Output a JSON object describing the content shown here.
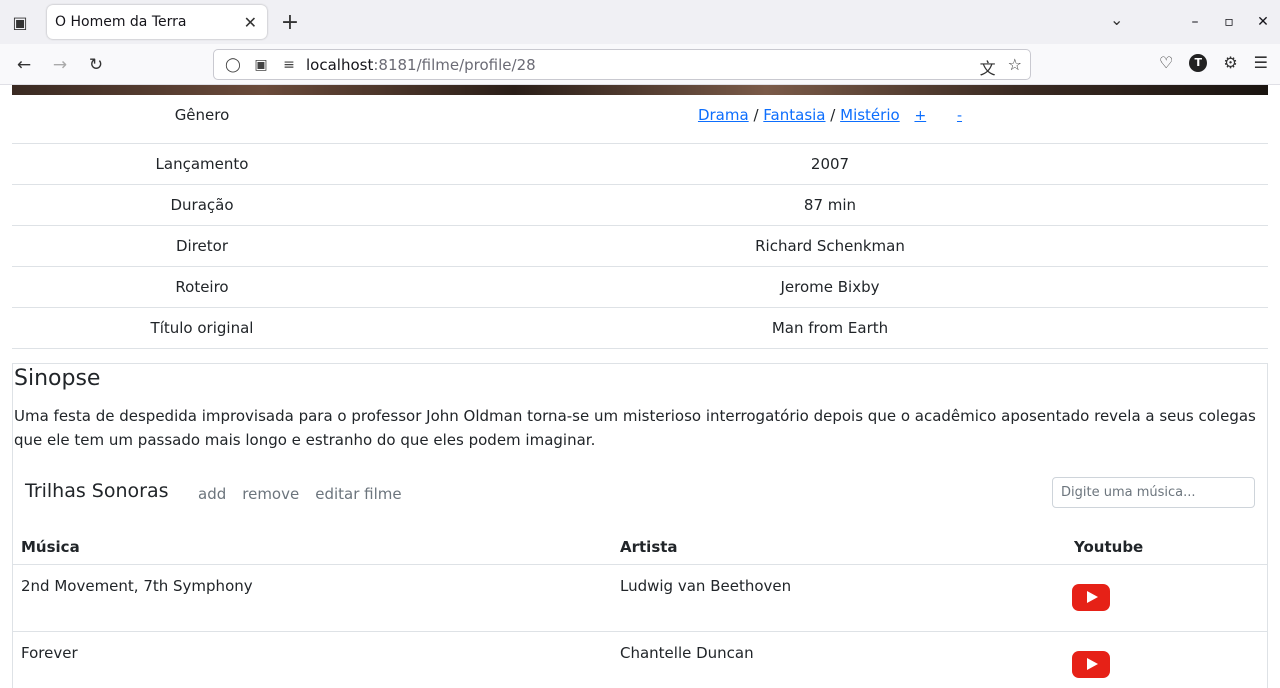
{
  "browser": {
    "tab_title": "O Homem da Terra",
    "url_host": "localhost",
    "url_path": ":8181/filme/profile/28",
    "avatar_letter": "T"
  },
  "info": {
    "genre_label": "Gênero",
    "genres": [
      "Drama",
      "Fantasia",
      "Mistério"
    ],
    "genre_add": "+",
    "genre_remove": "-",
    "rows": [
      {
        "label": "Lançamento",
        "value": "2007"
      },
      {
        "label": "Duração",
        "value": "87 min"
      },
      {
        "label": "Diretor",
        "value": "Richard Schenkman"
      },
      {
        "label": "Roteiro",
        "value": "Jerome Bixby"
      },
      {
        "label": "Título original",
        "value": "Man from Earth"
      }
    ]
  },
  "synopsis": {
    "title": "Sinopse",
    "text": "Uma festa de despedida improvisada para o professor John Oldman torna-se um misterioso interrogatório depois que o acadêmico aposentado revela a seus colegas que ele tem um passado mais longo e estranho do que eles podem imaginar."
  },
  "tracks": {
    "title": "Trilhas Sonoras",
    "add_label": "add",
    "remove_label": "remove",
    "edit_label": "editar filme",
    "search_placeholder": "Digite uma música...",
    "columns": {
      "music": "Música",
      "artist": "Artista",
      "youtube": "Youtube"
    },
    "rows": [
      {
        "music": "2nd Movement, 7th Symphony",
        "artist": "Ludwig van Beethoven"
      },
      {
        "music": "Forever",
        "artist": "Chantelle Duncan"
      }
    ]
  }
}
